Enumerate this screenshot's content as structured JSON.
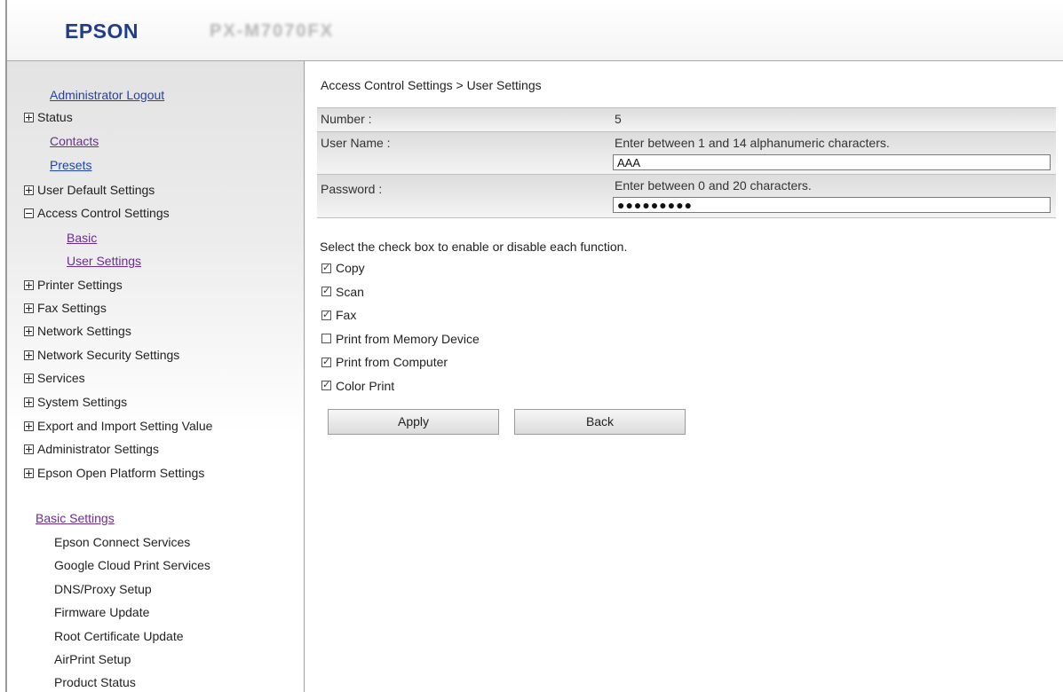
{
  "header": {
    "brand": "EPSON",
    "model": "PX-M7070FX"
  },
  "sidebar": {
    "admin_logout": "Administrator Logout",
    "items": [
      {
        "label": "Status",
        "expander": "plus"
      },
      {
        "label": "Contacts",
        "type": "link"
      },
      {
        "label": "Presets",
        "type": "link"
      },
      {
        "label": "User Default Settings",
        "expander": "plus"
      },
      {
        "label": "Access Control Settings",
        "expander": "minus"
      },
      {
        "label": "Basic",
        "type": "sublink"
      },
      {
        "label": "User Settings",
        "type": "sublink"
      },
      {
        "label": "Printer Settings",
        "expander": "plus"
      },
      {
        "label": "Fax Settings",
        "expander": "plus"
      },
      {
        "label": "Network Settings",
        "expander": "plus"
      },
      {
        "label": "Network Security Settings",
        "expander": "plus"
      },
      {
        "label": "Services",
        "expander": "plus"
      },
      {
        "label": "System Settings",
        "expander": "plus"
      },
      {
        "label": "Export and Import Setting Value",
        "expander": "plus"
      },
      {
        "label": "Administrator Settings",
        "expander": "plus"
      },
      {
        "label": "Epson Open Platform Settings",
        "expander": "plus"
      }
    ],
    "basic_settings": {
      "title": "Basic Settings",
      "items": [
        "Epson Connect Services",
        "Google Cloud Print Services",
        "DNS/Proxy Setup",
        "Firmware Update",
        "Root Certificate Update",
        "AirPrint Setup",
        "Product Status"
      ]
    }
  },
  "main": {
    "breadcrumb": "Access Control Settings > User Settings",
    "number_label": "Number :",
    "number_value": "5",
    "username_label": "User Name :",
    "username_hint": "Enter between 1 and 14 alphanumeric characters.",
    "username_value": "AAA",
    "password_label": "Password :",
    "password_hint": "Enter between 0 and 20 characters.",
    "password_value": "●●●●●●●●●",
    "instruction": "Select the check box to enable or disable each function.",
    "functions": [
      {
        "label": "Copy",
        "checked": true
      },
      {
        "label": "Scan",
        "checked": true
      },
      {
        "label": "Fax",
        "checked": true
      },
      {
        "label": "Print from Memory Device",
        "checked": false
      },
      {
        "label": "Print from Computer",
        "checked": true
      },
      {
        "label": "Color Print",
        "checked": true
      }
    ],
    "apply_label": "Apply",
    "back_label": "Back"
  }
}
